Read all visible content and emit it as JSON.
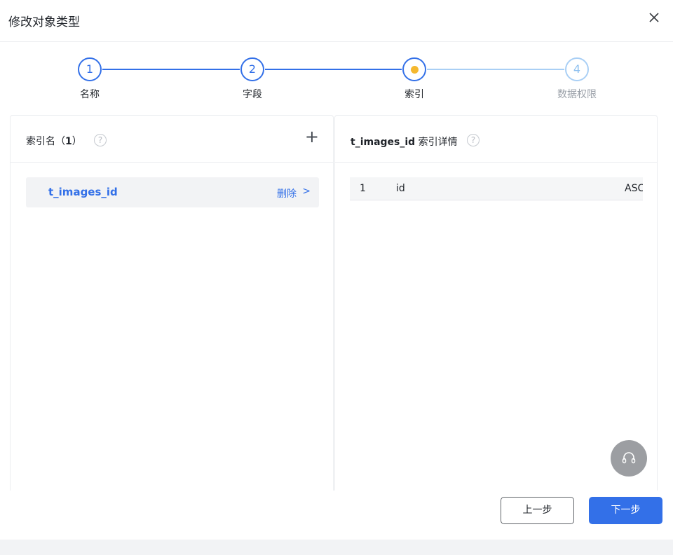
{
  "dialog": {
    "title": "修改对象类型",
    "close_icon": "close-icon"
  },
  "steps": [
    {
      "number": "1",
      "label": "名称",
      "status": "done"
    },
    {
      "number": "2",
      "label": "字段",
      "status": "done"
    },
    {
      "number": "",
      "label": "索引",
      "status": "current"
    },
    {
      "number": "4",
      "label": "数据权限",
      "status": "pending"
    }
  ],
  "index_panel": {
    "title_prefix": "索引名（",
    "count": "1",
    "title_suffix": "）",
    "help_icon": "help-circle-icon",
    "add_icon": "plus-icon",
    "items": [
      {
        "name": "t_images_id",
        "delete_label": "删除",
        "chevron": ">"
      }
    ]
  },
  "detail_panel": {
    "index_name": "t_images_id",
    "title_suffix": " 索引详情",
    "help_icon": "help-circle-icon",
    "rows": [
      {
        "order": "1",
        "column": "id",
        "sort": "ASC"
      }
    ]
  },
  "support_icon": "headset-icon",
  "footer": {
    "prev_label": "上一步",
    "next_label": "下一步"
  },
  "colors": {
    "primary": "#3370e8",
    "current_step": "#f5b82e",
    "pending_step": "#a9cff5"
  }
}
